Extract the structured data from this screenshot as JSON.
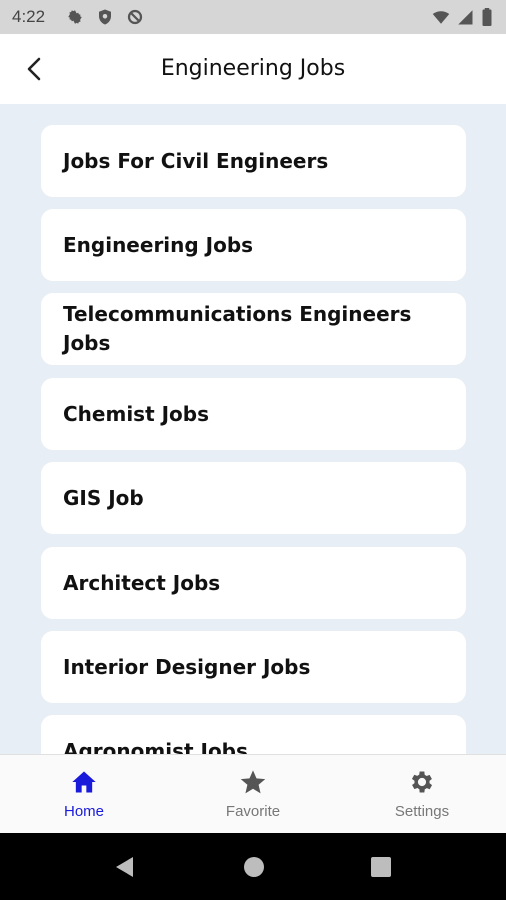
{
  "status_bar": {
    "time": "4:22"
  },
  "header": {
    "title": "Engineering Jobs"
  },
  "jobs": [
    {
      "label": "Jobs For Civil Engineers"
    },
    {
      "label": "Engineering Jobs"
    },
    {
      "label": "Telecommunications Engineers Jobs"
    },
    {
      "label": "Chemist Jobs"
    },
    {
      "label": "GIS Job"
    },
    {
      "label": "Architect Jobs"
    },
    {
      "label": "Interior Designer Jobs"
    },
    {
      "label": "Agronomist Jobs"
    }
  ],
  "bottom_nav": {
    "items": [
      {
        "label": "Home",
        "icon": "home-icon",
        "active": true
      },
      {
        "label": "Favorite",
        "icon": "star-icon",
        "active": false
      },
      {
        "label": "Settings",
        "icon": "gear-icon",
        "active": false
      }
    ]
  },
  "colors": {
    "active": "#1a1adb",
    "inactive": "#777777",
    "background": "#e8eef5"
  }
}
